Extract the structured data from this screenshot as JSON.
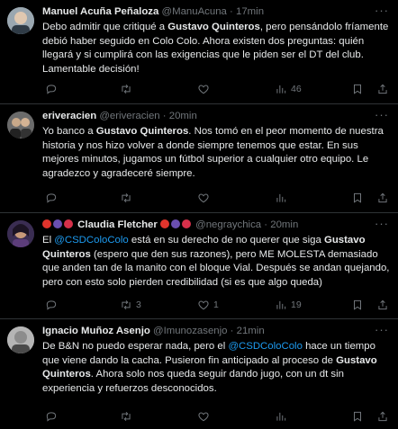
{
  "colors": {
    "background": "#000000",
    "text": "#e7e9ea",
    "muted": "#71767b",
    "link": "#1d9bf0",
    "divider": "#2f3336"
  },
  "tweets": [
    {
      "name": "Manuel Acuña Peñaloza",
      "handle": "@ManuAcuna",
      "sep": "·",
      "time": "17min",
      "text": {
        "p1": "Debo admitir que critiqué a ",
        "b1": "Gustavo Quinteros",
        "p2": ", pero pensándolo fríamente debió haber seguido en Colo Colo. Ahora existen dos preguntas: quién llegará y si cumplirá con las exigencias que le piden ser el DT del club. Lamentable decisión!"
      },
      "replies": "",
      "retweets": "",
      "likes": "",
      "views": "46"
    },
    {
      "name": "eriveracien",
      "handle": "@eriveracien",
      "sep": "·",
      "time": "20min",
      "text": {
        "p1": "Yo banco a ",
        "b1": "Gustavo Quinteros",
        "p2": ". Nos tomó en el peor momento de nuestra historia y nos hizo volver a donde siempre tenemos que estar. En sus mejores minutos, jugamos un fútbol superior a cualquier otro equipo. Le agradezco y agradeceré siempre."
      },
      "replies": "",
      "retweets": "",
      "likes": "",
      "views": ""
    },
    {
      "name_emoji_icons": [
        "red-ball-emoji",
        "grapes-emoji",
        "strawberry-emoji"
      ],
      "name": "Claudia Fletcher",
      "handle": "@negraychica",
      "sep": "·",
      "time": "20min",
      "text": {
        "p1": "El ",
        "mention": "@CSDColoColo",
        "p2": " está en su derecho de no querer que siga ",
        "b1": "Gustavo Quinteros",
        "p3": " (espero que den sus razones), pero ME MOLESTA demasiado que anden tan de la manito con el bloque Vial. Después se andan quejando, pero con esto solo pierden credibilidad (si es que algo queda)"
      },
      "replies": "",
      "retweets": "3",
      "likes": "1",
      "views": "19"
    },
    {
      "name": "Ignacio Muñoz Asenjo",
      "handle": "@Imunozasenjo",
      "sep": "·",
      "time": "21min",
      "text": {
        "p1": "De B&N no puedo esperar nada, pero el ",
        "mention": "@CSDColoColo",
        "p2": " hace un tiempo que viene dando la cacha. Pusieron fin anticipado al proceso de ",
        "b1": "Gustavo Quinteros",
        "p3": ". Ahora solo nos queda seguir dando jugo, con un dt sin experiencia y refuerzos desconocidos."
      },
      "replies": "",
      "retweets": "",
      "likes": "",
      "views": ""
    }
  ]
}
